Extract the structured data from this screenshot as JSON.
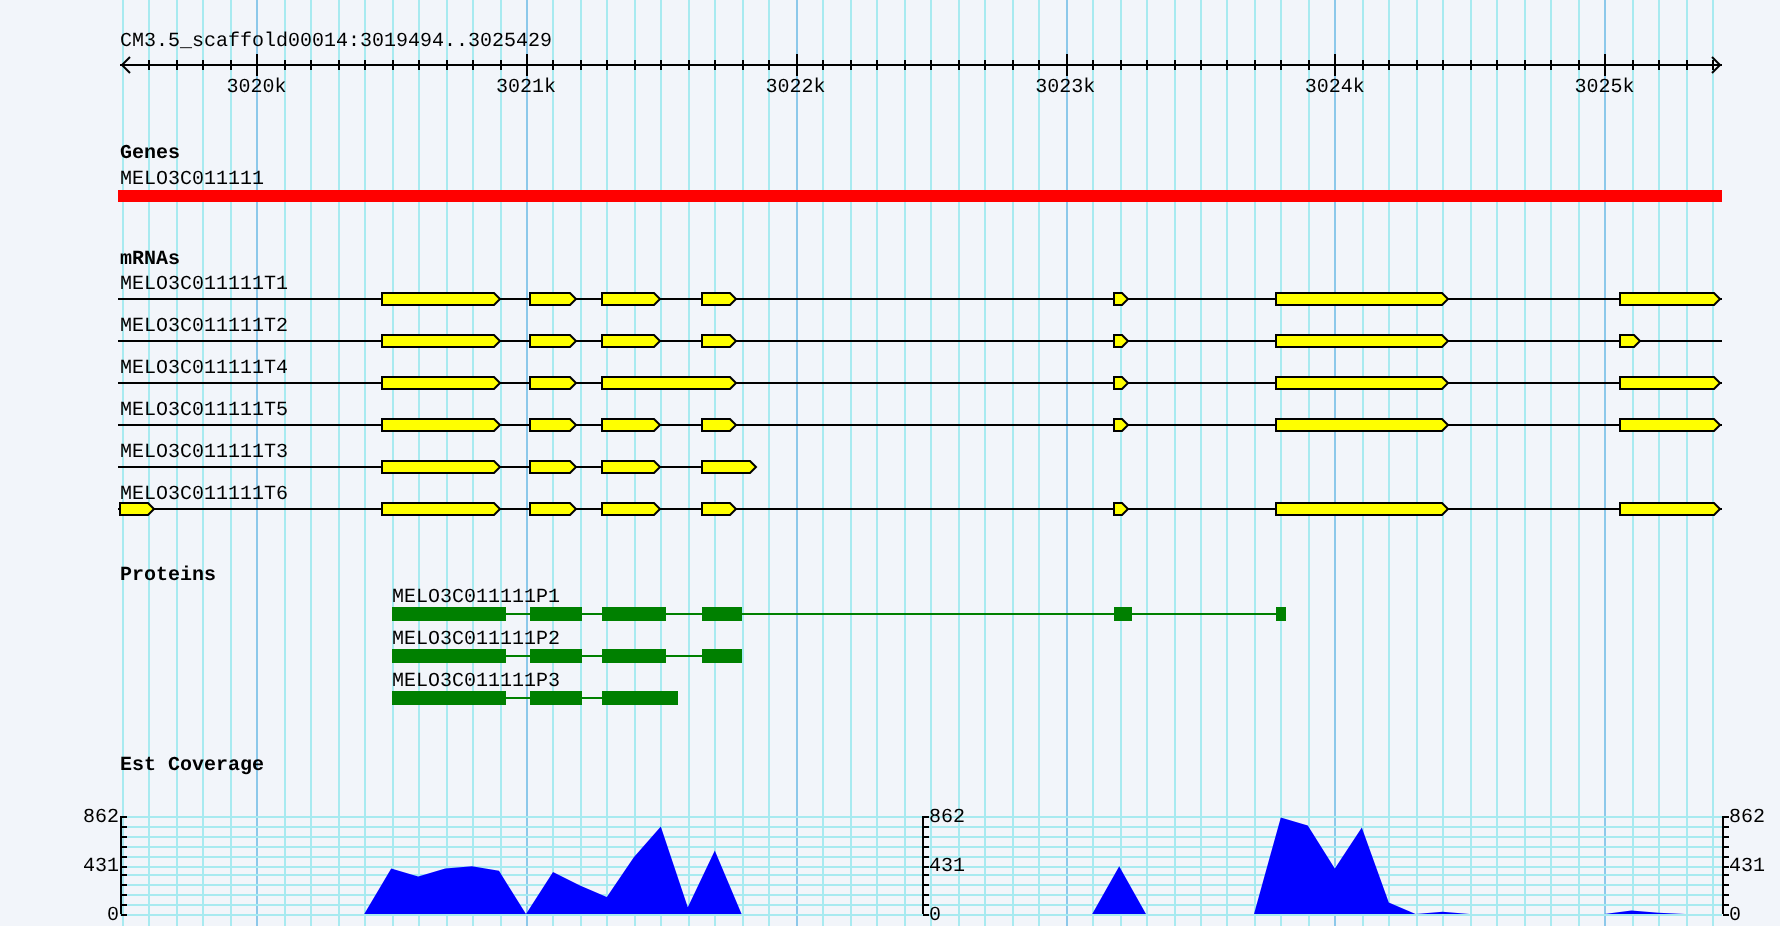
{
  "title": "CM3.5_scaffold00014:3019494..3025429",
  "ruler": {
    "labels": [
      "3020k",
      "3021k",
      "3022k",
      "3023k",
      "3024k",
      "3025k"
    ]
  },
  "tracks": [
    {
      "kind": "genes",
      "title": "Genes",
      "features": [
        {
          "label": "MELO3C011111"
        }
      ]
    },
    {
      "kind": "mrnas",
      "title": "mRNAs",
      "features": [
        {
          "label": "MELO3C011111T1"
        },
        {
          "label": "MELO3C011111T2"
        },
        {
          "label": "MELO3C011111T4"
        },
        {
          "label": "MELO3C011111T5"
        },
        {
          "label": "MELO3C011111T3"
        },
        {
          "label": "MELO3C011111T6"
        }
      ]
    },
    {
      "kind": "proteins",
      "title": "Proteins",
      "features": [
        {
          "label": "MELO3C011111P1"
        },
        {
          "label": "MELO3C011111P2"
        },
        {
          "label": "MELO3C011111P3"
        }
      ]
    },
    {
      "kind": "coverage",
      "title": "Est Coverage",
      "extra_axes": [
        {
          "labels": [
            "862",
            "431",
            "0"
          ]
        },
        {
          "labels": [
            "862",
            "431",
            "0"
          ]
        }
      ],
      "chart_data": {
        "type": "area",
        "categories": [
          null,
          null,
          null,
          null,
          null,
          null,
          null,
          null,
          null,
          null,
          null,
          null,
          null,
          null,
          null,
          null,
          null,
          null,
          null,
          null,
          null,
          null,
          null,
          null,
          null,
          null,
          null,
          null,
          null,
          null,
          null,
          null,
          null,
          null,
          null,
          null,
          null,
          null,
          null,
          null,
          null,
          null,
          null,
          null,
          null,
          null,
          null,
          null,
          null,
          null,
          null,
          null,
          null,
          null,
          null,
          null,
          null,
          null,
          null,
          null
        ],
        "ylim": [
          0,
          862
        ],
        "yticks": [
          {
            "value": 0,
            "label": "0"
          },
          {
            "value": 431,
            "label": "431"
          },
          {
            "value": 862,
            "label": "862"
          }
        ],
        "series": [
          {
            "color": "#0000ff",
            "values": [
              0,
              0,
              0,
              0,
              0,
              0,
              0,
              0,
              0,
              0,
              400,
              330,
              400,
              420,
              380,
              0,
              370,
              250,
              150,
              500,
              770,
              60,
              560,
              0,
              0,
              0,
              0,
              0,
              0,
              0,
              0,
              0,
              0,
              0,
              0,
              0,
              0,
              420,
              0,
              0,
              0,
              0,
              0,
              850,
              780,
              400,
              760,
              100,
              0,
              20,
              0,
              0,
              0,
              0,
              0,
              0,
              30,
              10,
              0,
              0
            ]
          }
        ]
      }
    }
  ]
}
